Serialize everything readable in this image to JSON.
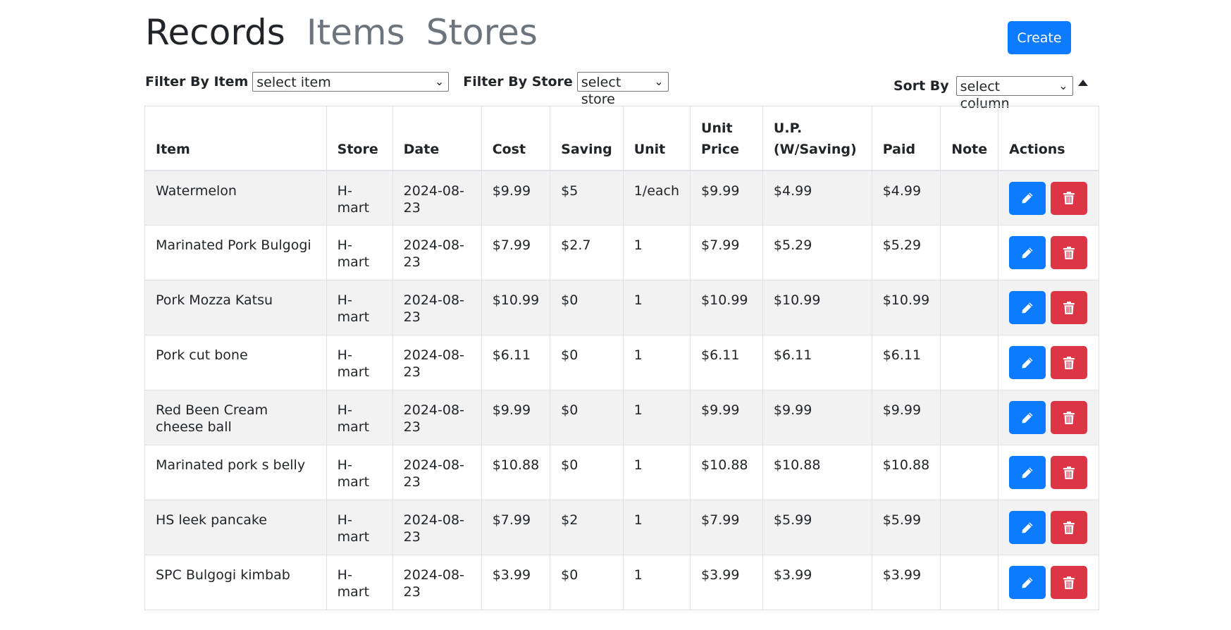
{
  "nav": {
    "tabs": [
      {
        "label": "Records"
      },
      {
        "label": "Items"
      },
      {
        "label": "Stores"
      }
    ]
  },
  "toolbar": {
    "create_label": "Create"
  },
  "filters": {
    "item_label": "Filter By Item",
    "item_value": "select item",
    "store_label": "Filter By Store",
    "store_value": "select store"
  },
  "sort": {
    "label": "Sort By",
    "value": "select column",
    "direction_icon": "triangle-up-icon"
  },
  "table": {
    "headers": [
      "Item",
      "Store",
      "Date",
      "Cost",
      "Saving",
      "Unit",
      "Unit Price",
      "U.P. (W/Saving)",
      "Paid",
      "Note",
      "Actions"
    ],
    "rows": [
      {
        "item": "Watermelon",
        "store": "H-mart",
        "date": "2024-08-23",
        "cost": "$9.99",
        "saving": "$5",
        "unit": "1/each",
        "unit_price": "$9.99",
        "up_saving": "$4.99",
        "paid": "$4.99",
        "note": ""
      },
      {
        "item": "Marinated Pork Bulgogi",
        "store": "H-mart",
        "date": "2024-08-23",
        "cost": "$7.99",
        "saving": "$2.7",
        "unit": "1",
        "unit_price": "$7.99",
        "up_saving": "$5.29",
        "paid": "$5.29",
        "note": ""
      },
      {
        "item": "Pork Mozza Katsu",
        "store": "H-mart",
        "date": "2024-08-23",
        "cost": "$10.99",
        "saving": "$0",
        "unit": "1",
        "unit_price": "$10.99",
        "up_saving": "$10.99",
        "paid": "$10.99",
        "note": ""
      },
      {
        "item": "Pork cut bone",
        "store": "H-mart",
        "date": "2024-08-23",
        "cost": "$6.11",
        "saving": "$0",
        "unit": "1",
        "unit_price": "$6.11",
        "up_saving": "$6.11",
        "paid": "$6.11",
        "note": ""
      },
      {
        "item": "Red Been Cream cheese ball",
        "store": "H-mart",
        "date": "2024-08-23",
        "cost": "$9.99",
        "saving": "$0",
        "unit": "1",
        "unit_price": "$9.99",
        "up_saving": "$9.99",
        "paid": "$9.99",
        "note": ""
      },
      {
        "item": "Marinated pork s belly",
        "store": "H-mart",
        "date": "2024-08-23",
        "cost": "$10.88",
        "saving": "$0",
        "unit": "1",
        "unit_price": "$10.88",
        "up_saving": "$10.88",
        "paid": "$10.88",
        "note": ""
      },
      {
        "item": "HS leek pancake",
        "store": "H-mart",
        "date": "2024-08-23",
        "cost": "$7.99",
        "saving": "$2",
        "unit": "1",
        "unit_price": "$7.99",
        "up_saving": "$5.99",
        "paid": "$5.99",
        "note": ""
      },
      {
        "item": "SPC Bulgogi kimbab",
        "store": "H-mart",
        "date": "2024-08-23",
        "cost": "$3.99",
        "saving": "$0",
        "unit": "1",
        "unit_price": "$3.99",
        "up_saving": "$3.99",
        "paid": "$3.99",
        "note": ""
      }
    ],
    "row_actions": {
      "edit_icon": "pencil-icon",
      "delete_icon": "trash-icon"
    }
  },
  "colors": {
    "primary": "#0d7bff",
    "danger": "#dc3545",
    "muted": "#6c757d",
    "stripe": "#f2f2f2"
  }
}
